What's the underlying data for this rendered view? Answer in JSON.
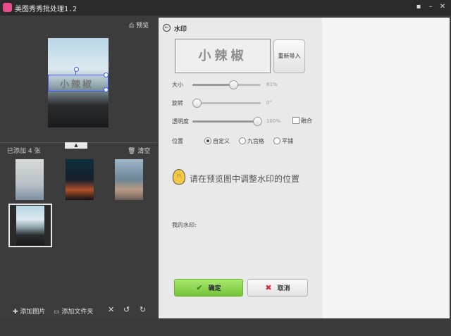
{
  "window": {
    "title": "美图秀秀批处理1.2"
  },
  "left_panel": {
    "preview_label": "预览",
    "watermark_overlay_text": "小辣椒",
    "added_count": "已添加 4 张",
    "clear_label": "清空",
    "add_image_label": "添加图片",
    "add_folder_label": "添加文件夹"
  },
  "watermark_panel": {
    "title": "水印",
    "preview_text": "小辣椒",
    "reimport_label": "重新导入",
    "size_label": "大小",
    "size_value": "61%",
    "size_level": 0.61,
    "rotate_label": "旋转",
    "rotate_value": "0°",
    "rotate_level": 0,
    "opacity_label": "透明度",
    "opacity_value": "100%",
    "opacity_level": 1.0,
    "blend_label": "融合",
    "position_label": "位置",
    "position_options": [
      "自定义",
      "九宫格",
      "平铺"
    ],
    "tip_text": "请在预览图中调整水印的位置",
    "my_watermark_label": "我的水印:",
    "ok_label": "确定",
    "cancel_label": "取消"
  },
  "colors": {
    "accent_blue": "#3b58ff",
    "ok_green": "#74c33a",
    "cancel_red": "#d23030"
  }
}
